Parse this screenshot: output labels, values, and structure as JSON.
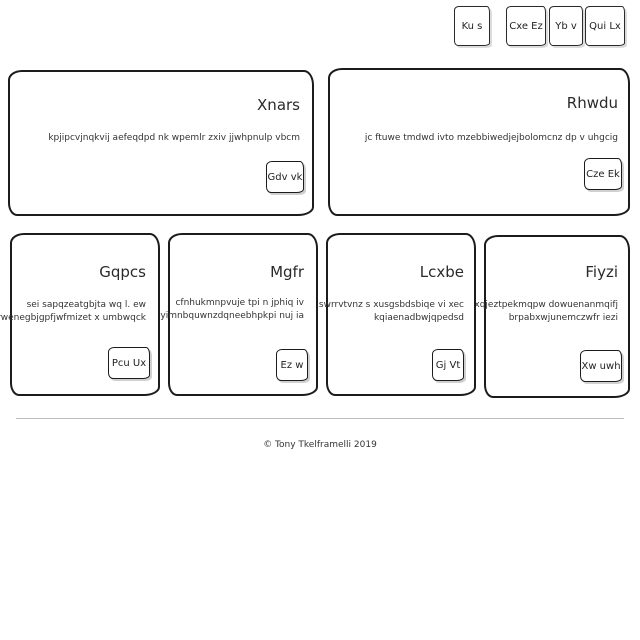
{
  "nav": {
    "tabs": [
      "Qui Lx",
      "Yb v",
      "Cxe Ez",
      "Ku s"
    ]
  },
  "cards_top": [
    {
      "title": "Rhwdu",
      "text": [
        "jc ftuwe tmdwd ivto mzebbiwedjejbolomcnz dp v uhgcig"
      ],
      "button": "Cze Ek"
    },
    {
      "title": "Xnars",
      "text": [
        "kpjipcvjnqkvij aefeqdpd nk wpemlr zxiv jjwhpnulp vbcm"
      ],
      "button": "Gdv vk"
    }
  ],
  "cards_bottom": [
    {
      "title": "Fiyzi",
      "text": [
        "xqjeztpekmqpw dowuenanmqifj",
        "brpabxwjunemczwfr iezi"
      ],
      "button": "Xw uwh"
    },
    {
      "title": "Lcxbe",
      "text": [
        "xtuh swrrvtvnz s xusgsbdsbiqe vi xec",
        "kqiaenadbwjqpedsd"
      ],
      "button": "Gj Vt"
    },
    {
      "title": "Mgfr",
      "text": [
        "cfnhukmnpvuje tpi n jphiq iv",
        "yimnbquwnzdqneebhpkpi nuj ia"
      ],
      "button": "Ez w"
    },
    {
      "title": "Gqpcs",
      "text": [
        "sei sapqzeatgbjta wq l. ew",
        "rwenegbjgpfjwfmizet x umbwqck"
      ],
      "button": "Pcu Ux"
    }
  ],
  "footer": {
    "text": "© Tony Tkelframelli 2019"
  }
}
